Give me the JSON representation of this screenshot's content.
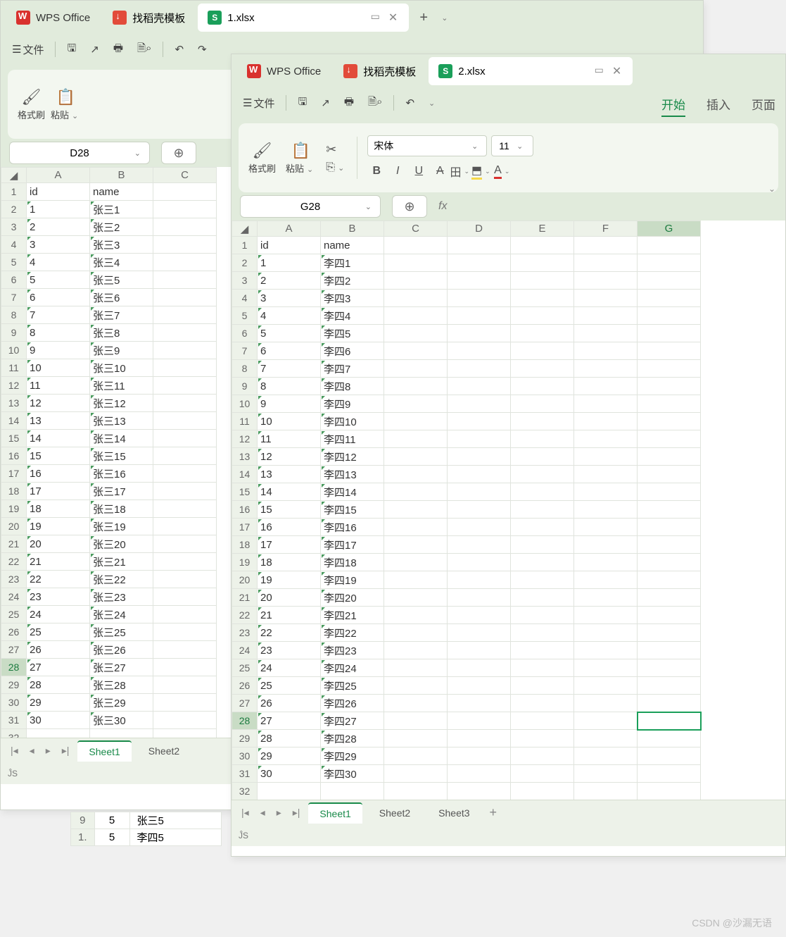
{
  "app_name": "WPS Office",
  "docker_tab": "找稻壳模板",
  "win1": {
    "file_tab": "1.xlsx",
    "file_menu": "文件",
    "namebox": "D28",
    "ribbon": {
      "brush": "格式刷",
      "paste": "粘贴"
    },
    "headers": [
      "A",
      "B",
      "C"
    ],
    "row1": {
      "a": "id",
      "b": "name"
    },
    "data_prefix": "张三",
    "sheets": [
      "Sheet1",
      "Sheet2"
    ],
    "current_row": 28
  },
  "win2": {
    "file_tab": "2.xlsx",
    "file_menu": "文件",
    "namebox": "G28",
    "ribbon_tabs": [
      "开始",
      "插入",
      "页面"
    ],
    "ribbon": {
      "brush": "格式刷",
      "paste": "粘贴"
    },
    "font": "宋体",
    "fontsize": "11",
    "headers": [
      "A",
      "B",
      "C",
      "D",
      "E",
      "F",
      "G"
    ],
    "row1": {
      "a": "id",
      "b": "name"
    },
    "data_prefix": "李四",
    "sheets": [
      "Sheet1",
      "Sheet2",
      "Sheet3"
    ],
    "current_row": 28
  },
  "float": {
    "r1": [
      "9",
      "5",
      "张三5"
    ],
    "r2": [
      "1.",
      "5",
      "李四5"
    ]
  },
  "watermark": "CSDN @沙漏无语"
}
